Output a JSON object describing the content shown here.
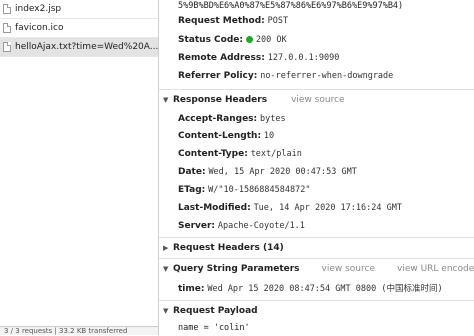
{
  "requests": [
    {
      "name": "index2.jsp",
      "selected": false
    },
    {
      "name": "favicon.ico",
      "selected": false
    },
    {
      "name": "helloAjax.txt?time=Wed%20A...",
      "selected": true
    }
  ],
  "status_bar": "3 / 3 requests | 33.2 KB transferred",
  "general": {
    "url_tail": "5%9B%BD%E6%A0%87%E5%87%86%E6%97%B6%E9%97%B4)",
    "request_method": {
      "key": "Request Method:",
      "value": "POST"
    },
    "status_code": {
      "key": "Status Code:",
      "value": "200 OK",
      "color": "#1aab29"
    },
    "remote_address": {
      "key": "Remote Address:",
      "value": "127.0.0.1:9090"
    },
    "referrer_policy": {
      "key": "Referrer Policy:",
      "value": "no-referrer-when-downgrade"
    }
  },
  "response_headers": {
    "title": "Response Headers",
    "view_source": "view source",
    "items": [
      {
        "key": "Accept-Ranges:",
        "value": "bytes"
      },
      {
        "key": "Content-Length:",
        "value": "10"
      },
      {
        "key": "Content-Type:",
        "value": "text/plain"
      },
      {
        "key": "Date:",
        "value": "Wed, 15 Apr 2020 00:47:53 GMT"
      },
      {
        "key": "ETag:",
        "value": "W/\"10-1586884584872\""
      },
      {
        "key": "Last-Modified:",
        "value": "Tue, 14 Apr 2020 17:16:24 GMT"
      },
      {
        "key": "Server:",
        "value": "Apache-Coyote/1.1"
      }
    ]
  },
  "request_headers": {
    "title": "Request Headers (14)"
  },
  "query_string": {
    "title": "Query String Parameters",
    "view_source": "view source",
    "view_url_encoded": "view URL encoded",
    "param": {
      "key": "time:",
      "value": "Wed Apr 15 2020 08:47:54 GMT 0800 (中国标准时间)"
    }
  },
  "request_payload": {
    "title": "Request Payload",
    "line": "name = 'colin'"
  }
}
